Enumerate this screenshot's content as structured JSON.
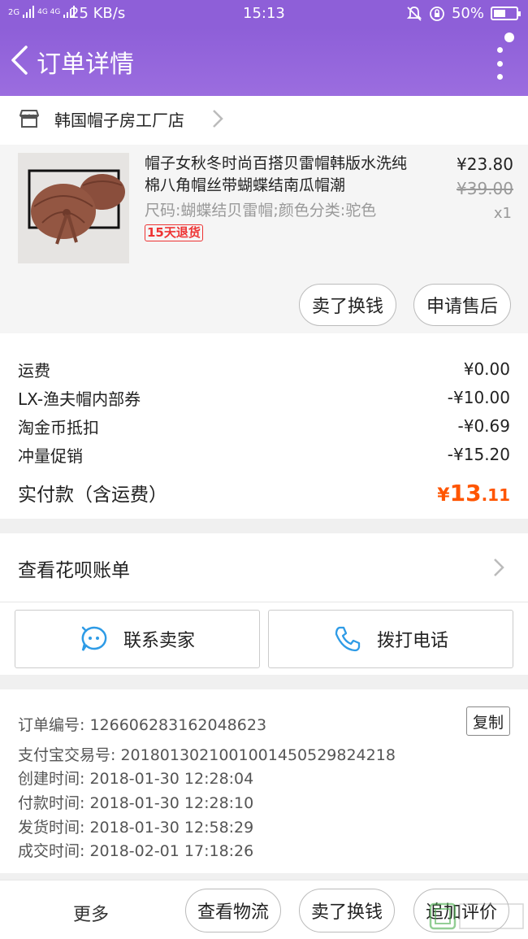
{
  "status_bar": {
    "signal_1": "2G",
    "signal_2": "4G 4G",
    "net_speed": "25 KB/s",
    "time": "15:13",
    "battery": "50%"
  },
  "nav": {
    "title": "订单详情"
  },
  "shop": {
    "name": "韩国帽子房工厂店"
  },
  "product": {
    "title": "帽子女秋冬时尚百搭贝雷帽韩版水洗纯棉八角帽丝带蝴蝶结南瓜帽潮",
    "spec": "尺码:蝴蝶结贝雷帽;颜色分类:驼色",
    "badge": "15天退货",
    "price": "¥23.80",
    "original_price": "¥39.00",
    "quantity": "x1",
    "actions": [
      "卖了换钱",
      "申请售后"
    ]
  },
  "fees": [
    {
      "label": "运费",
      "value": "¥0.00"
    },
    {
      "label": "LX-渔夫帽内部券",
      "value": "-¥10.00"
    },
    {
      "label": "淘金币抵扣",
      "value": "-¥0.69"
    },
    {
      "label": "冲量促销",
      "value": "-¥15.20"
    }
  ],
  "total": {
    "label": "实付款（含运费）",
    "currency": "¥",
    "integer": "13",
    "decimal": ".11"
  },
  "huabei": {
    "label": "查看花呗账单"
  },
  "contact": {
    "seller": "联系卖家",
    "call": "拨打电话"
  },
  "order_info": {
    "order_no": "订单编号: 1266062831620486​23",
    "copy": "复制",
    "alipay_no": "支付宝交易号: 2018013021001001450529824218",
    "created": "创建时间: 2018-01-30 12:28:04",
    "paid": "付款时间: 2018-01-30 12:28:10",
    "shipped": "发货时间: 2018-01-30 12:58:29",
    "completed": "成交时间: 2018-02-01 17:18:26"
  },
  "bottom_bar": {
    "more": "更多",
    "logistics": "查看物流",
    "sell": "卖了换钱",
    "review": "追加评价"
  },
  "colors": {
    "brand_purple": "#8e5fd8",
    "price_orange": "#ff5500",
    "badge_red": "#e33333"
  }
}
